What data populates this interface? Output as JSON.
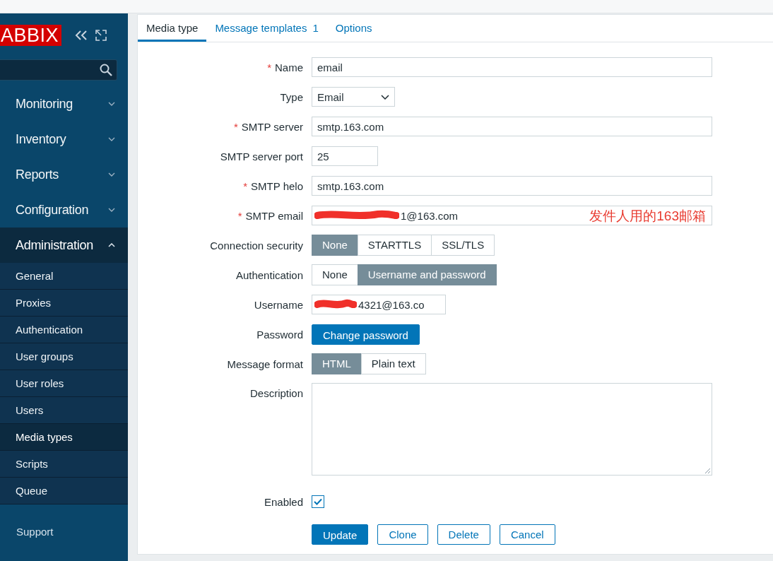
{
  "sidebar": {
    "logo": "ABBIX",
    "menu": [
      {
        "label": "Monitoring",
        "expanded": false
      },
      {
        "label": "Inventory",
        "expanded": false
      },
      {
        "label": "Reports",
        "expanded": false
      },
      {
        "label": "Configuration",
        "expanded": false
      },
      {
        "label": "Administration",
        "expanded": true,
        "children": [
          {
            "label": "General",
            "selected": false
          },
          {
            "label": "Proxies",
            "selected": false
          },
          {
            "label": "Authentication",
            "selected": false
          },
          {
            "label": "User groups",
            "selected": false
          },
          {
            "label": "User roles",
            "selected": false
          },
          {
            "label": "Users",
            "selected": false
          },
          {
            "label": "Media types",
            "selected": true
          },
          {
            "label": "Scripts",
            "selected": false
          },
          {
            "label": "Queue",
            "selected": false
          }
        ]
      }
    ],
    "support": "Support"
  },
  "tabs": [
    {
      "label": "Media type",
      "selected": true
    },
    {
      "label": "Message templates",
      "count": "1",
      "selected": false
    },
    {
      "label": "Options",
      "selected": false
    }
  ],
  "form": {
    "fields": [
      {
        "kind": "text",
        "marker": "*",
        "label": "Name",
        "value": "email"
      },
      {
        "kind": "select",
        "label": "Type",
        "value": "Email"
      },
      {
        "kind": "text",
        "marker": "*",
        "label": "SMTP server",
        "value": "smtp.163.com"
      },
      {
        "kind": "number",
        "label": "SMTP server port",
        "value": "25"
      },
      {
        "kind": "text",
        "marker": "*",
        "label": "SMTP helo",
        "value": "smtp.163.com"
      },
      {
        "kind": "text",
        "marker": "*",
        "label": "SMTP email",
        "redacted": true,
        "value": "1@163.com",
        "note": "发件人用的163邮箱"
      },
      {
        "kind": "segmented",
        "label": "Connection security",
        "options": [
          {
            "label": "None",
            "selected": true
          },
          {
            "label": "STARTTLS",
            "selected": false
          },
          {
            "label": "SSL/TLS",
            "selected": false
          }
        ]
      },
      {
        "kind": "segmented",
        "label": "Authentication",
        "options": [
          {
            "label": "None",
            "selected": false
          },
          {
            "label": "Username and password",
            "selected": true
          }
        ]
      },
      {
        "kind": "login",
        "label": "Username",
        "redacted": true,
        "value": "4321@163.co"
      },
      {
        "kind": "button",
        "label": "Password",
        "button": "Change password"
      },
      {
        "kind": "segmented",
        "label": "Message format",
        "options": [
          {
            "label": "HTML",
            "selected": true
          },
          {
            "label": "Plain text",
            "selected": false
          }
        ]
      },
      {
        "kind": "textarea",
        "label": "Description"
      },
      {
        "kind": "checkbox",
        "label": "Enabled",
        "checked": true
      }
    ],
    "buttons": [
      {
        "label": "Update",
        "primary": true
      },
      {
        "label": "Clone",
        "primary": false
      },
      {
        "label": "Delete",
        "primary": false
      },
      {
        "label": "Cancel",
        "primary": false
      }
    ]
  }
}
